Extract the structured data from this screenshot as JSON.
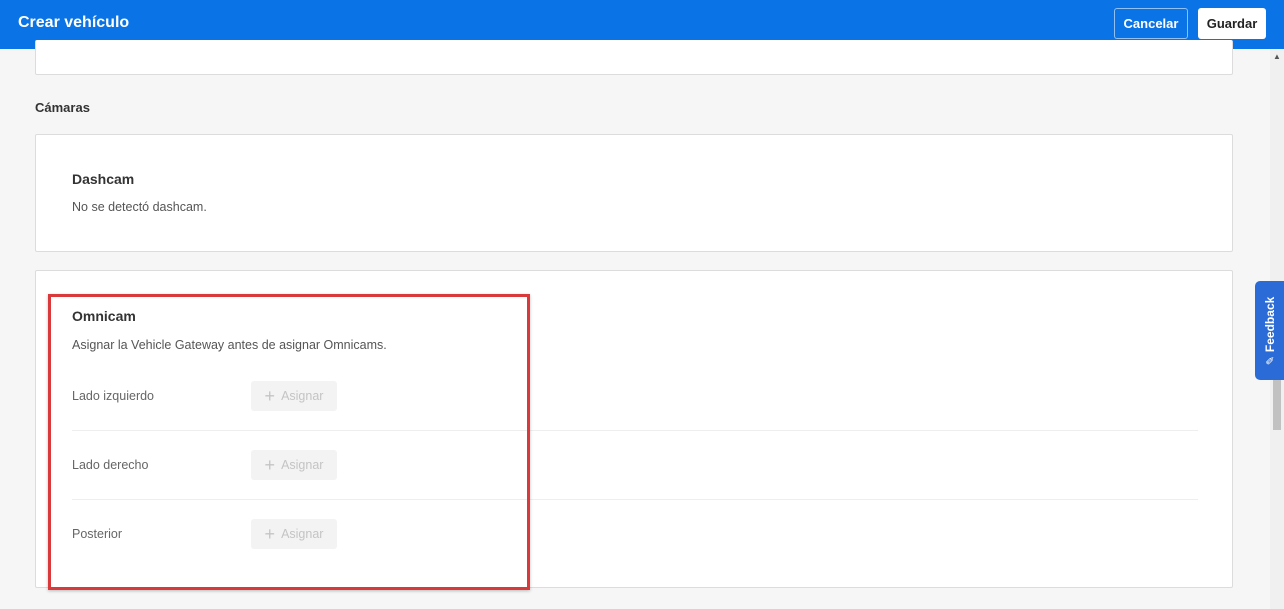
{
  "header": {
    "title": "Crear vehículo",
    "cancel_label": "Cancelar",
    "save_label": "Guardar"
  },
  "cameras": {
    "section_title": "Cámaras",
    "dashcam": {
      "heading": "Dashcam",
      "status": "No se detectó dashcam."
    },
    "omnicam": {
      "heading": "Omnicam",
      "note": "Asignar la Vehicle Gateway antes de asignar Omnicams.",
      "rows": [
        {
          "label": "Lado izquierdo",
          "button": "Asignar"
        },
        {
          "label": "Lado derecho",
          "button": "Asignar"
        },
        {
          "label": "Posterior",
          "button": "Asignar"
        }
      ]
    }
  },
  "feedback_tab": {
    "label": "Feedback",
    "icon": "feedback-icon"
  },
  "colors": {
    "header_bg": "#0a73e6",
    "highlight": "#d9393b",
    "feedback_bg": "#2a6bd8"
  }
}
